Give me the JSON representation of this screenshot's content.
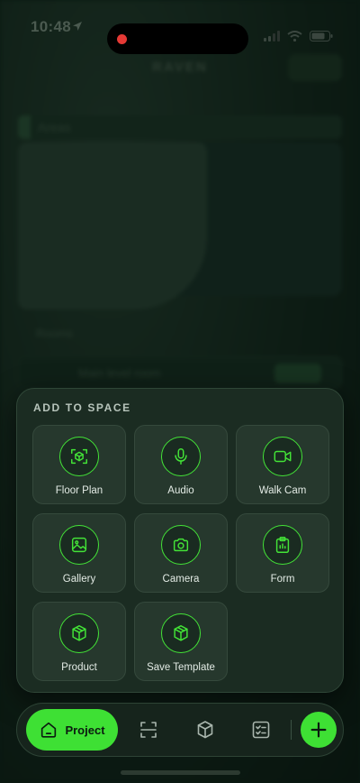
{
  "status_bar": {
    "time": "10:48"
  },
  "background": {
    "title": "RAVEN",
    "section_1": "Areas",
    "section_2": "Rooms",
    "row_label": "Main level room"
  },
  "sheet": {
    "title": "ADD TO SPACE",
    "tiles": [
      {
        "label": "Floor Plan",
        "icon": "floor-plan-icon"
      },
      {
        "label": "Audio",
        "icon": "microphone-icon"
      },
      {
        "label": "Walk Cam",
        "icon": "video-camera-icon"
      },
      {
        "label": "Gallery",
        "icon": "image-icon"
      },
      {
        "label": "Camera",
        "icon": "camera-icon"
      },
      {
        "label": "Form",
        "icon": "clipboard-icon"
      },
      {
        "label": "Product",
        "icon": "box-icon"
      },
      {
        "label": "Save Template",
        "icon": "box-icon"
      }
    ]
  },
  "navbar": {
    "project_label": "Project",
    "items": [
      "scan-icon",
      "box-icon",
      "checklist-icon"
    ],
    "add_icon": "plus-icon"
  },
  "colors": {
    "accent": "#3ee034",
    "sheet_bg": "#1b2c22",
    "tile_bg": "#26382d"
  }
}
